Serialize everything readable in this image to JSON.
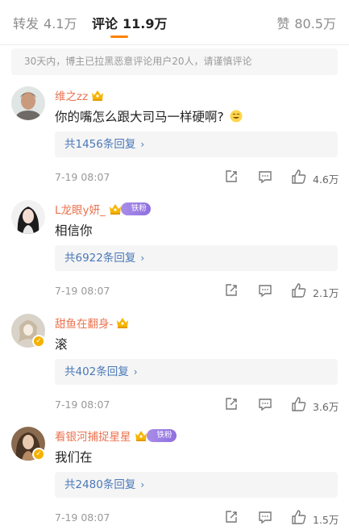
{
  "tabs": {
    "repost": {
      "label": "转发",
      "count": "4.1万"
    },
    "comment": {
      "label": "评论",
      "count": "11.9万"
    },
    "like": {
      "label": "赞",
      "count": "80.5万"
    }
  },
  "notice": "30天内，博主已拉黑恶意评论用户20人，请谨慎评论",
  "comments": [
    {
      "username": "维之zz",
      "text": "你的嘴怎么跟大司马一样硬啊?",
      "replies": "共1456条回复",
      "time": "7-19 08:07",
      "likes": "4.6万",
      "fan_badge": ""
    },
    {
      "username": "L龙眼y妍_",
      "text": "相信你",
      "replies": "共6922条回复",
      "time": "7-19 08:07",
      "likes": "2.1万",
      "fan_badge": "铁粉"
    },
    {
      "username": "甜鱼在翻身-",
      "text": "滚",
      "replies": "共402条回复",
      "time": "7-19 08:07",
      "likes": "3.6万",
      "fan_badge": ""
    },
    {
      "username": "看银河捕捉星星",
      "text": "我们在",
      "replies": "共2480条回复",
      "time": "7-19 08:07",
      "likes": "1.5万",
      "fan_badge": "铁粉"
    }
  ],
  "colors": {
    "accent": "#ff8200",
    "username": "#eb7350",
    "reply_link": "#4a78b8",
    "fan_badge": "#8f6fe0"
  },
  "icons": [
    "crown-icon",
    "verify-icon",
    "chevron-right-icon",
    "share-icon",
    "reply-icon",
    "like-icon",
    "emoji-icon"
  ]
}
